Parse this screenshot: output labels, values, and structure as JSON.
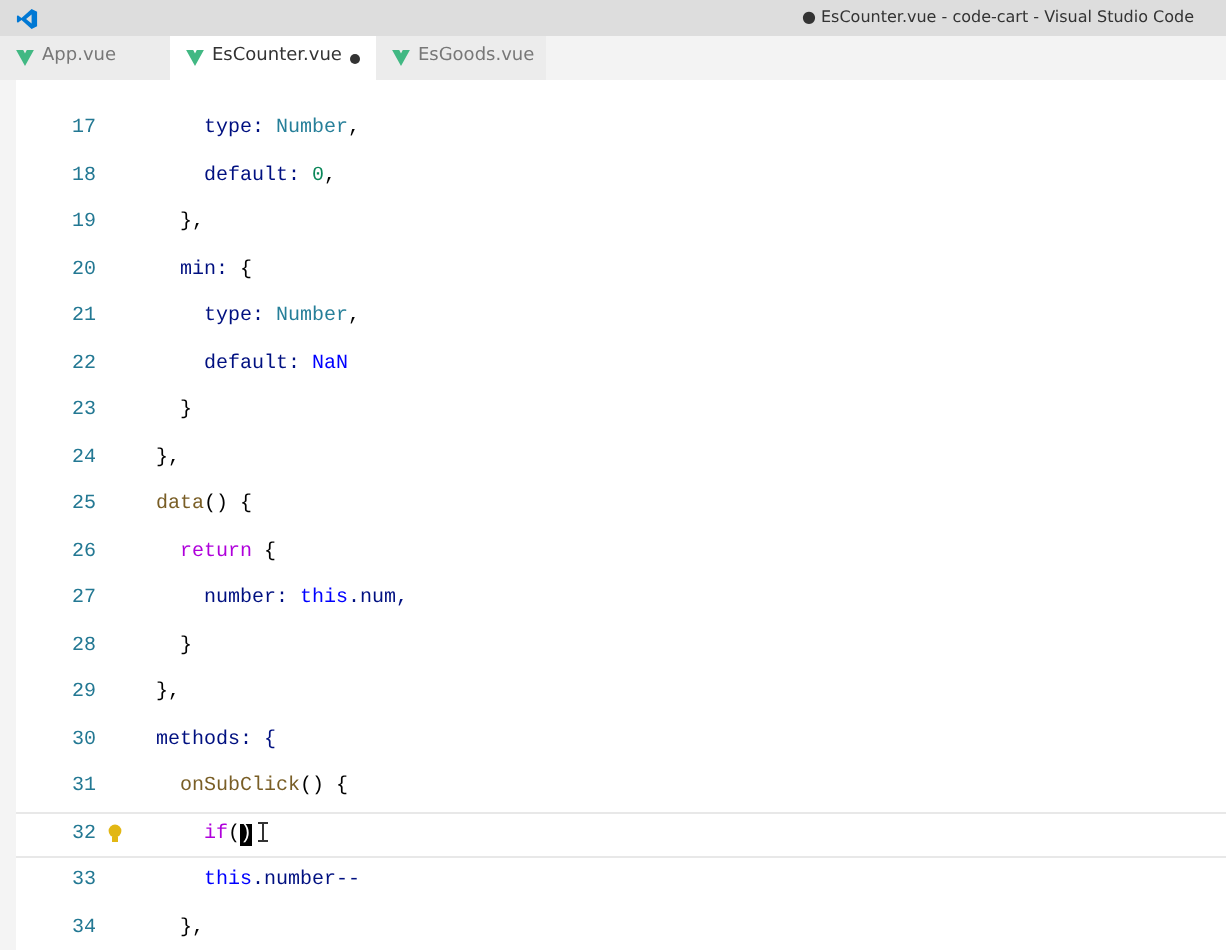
{
  "window": {
    "title": "● EsCounter.vue - code-cart - Visual Studio Code"
  },
  "tabs": [
    {
      "label": "App.vue",
      "selected": false,
      "modified": false
    },
    {
      "label": "EsCounter.vue",
      "selected": true,
      "modified": true
    },
    {
      "label": "EsGoods.vue",
      "selected": false,
      "modified": false
    }
  ],
  "editor": {
    "lines": [
      {
        "number": "17",
        "active": false,
        "tokens": [
          {
            "text": "      type: ",
            "kind": "prop"
          },
          {
            "text": "Number",
            "kind": "type"
          },
          {
            "text": ",",
            "kind": "plain"
          }
        ]
      },
      {
        "number": "18",
        "active": false,
        "tokens": [
          {
            "text": "      default: ",
            "kind": "prop"
          },
          {
            "text": "0",
            "kind": "num"
          },
          {
            "text": ",",
            "kind": "plain"
          }
        ]
      },
      {
        "number": "19",
        "active": false,
        "tokens": [
          {
            "text": "    },",
            "kind": "plain"
          }
        ]
      },
      {
        "number": "20",
        "active": false,
        "tokens": [
          {
            "text": "    min: ",
            "kind": "prop"
          },
          {
            "text": "{",
            "kind": "plain"
          }
        ]
      },
      {
        "number": "21",
        "active": false,
        "tokens": [
          {
            "text": "      type: ",
            "kind": "prop"
          },
          {
            "text": "Number",
            "kind": "type"
          },
          {
            "text": ",",
            "kind": "plain"
          }
        ]
      },
      {
        "number": "22",
        "active": false,
        "tokens": [
          {
            "text": "      default: ",
            "kind": "prop"
          },
          {
            "text": "NaN",
            "kind": "const"
          }
        ]
      },
      {
        "number": "23",
        "active": false,
        "tokens": [
          {
            "text": "    }",
            "kind": "plain"
          }
        ]
      },
      {
        "number": "24",
        "active": false,
        "tokens": [
          {
            "text": "  },",
            "kind": "plain"
          }
        ]
      },
      {
        "number": "25",
        "active": false,
        "tokens": [
          {
            "text": "  data",
            "kind": "func"
          },
          {
            "text": "() {",
            "kind": "plain"
          }
        ]
      },
      {
        "number": "26",
        "active": false,
        "tokens": [
          {
            "text": "    return",
            "kind": "keyword"
          },
          {
            "text": " {",
            "kind": "plain"
          }
        ]
      },
      {
        "number": "27",
        "active": false,
        "tokens": [
          {
            "text": "      number: ",
            "kind": "prop"
          },
          {
            "text": "this",
            "kind": "const"
          },
          {
            "text": ".num,",
            "kind": "prop"
          }
        ]
      },
      {
        "number": "28",
        "active": false,
        "tokens": [
          {
            "text": "    }",
            "kind": "plain"
          }
        ]
      },
      {
        "number": "29",
        "active": false,
        "tokens": [
          {
            "text": "  },",
            "kind": "plain"
          }
        ]
      },
      {
        "number": "30",
        "active": false,
        "tokens": [
          {
            "text": "  methods: {",
            "kind": "prop"
          }
        ]
      },
      {
        "number": "31",
        "active": false,
        "tokens": [
          {
            "text": "    onSubClick",
            "kind": "func"
          },
          {
            "text": "() {",
            "kind": "plain"
          }
        ]
      },
      {
        "number": "32",
        "active": true,
        "tokens": [
          {
            "text": "      if",
            "kind": "keyword"
          },
          {
            "text": "(",
            "kind": "plain"
          },
          {
            "text": ")",
            "kind": "cursor"
          }
        ]
      },
      {
        "number": "33",
        "active": false,
        "tokens": [
          {
            "text": "      this",
            "kind": "const"
          },
          {
            "text": ".number--",
            "kind": "prop"
          }
        ]
      },
      {
        "number": "34",
        "active": false,
        "tokens": [
          {
            "text": "    },",
            "kind": "plain"
          }
        ]
      }
    ]
  }
}
